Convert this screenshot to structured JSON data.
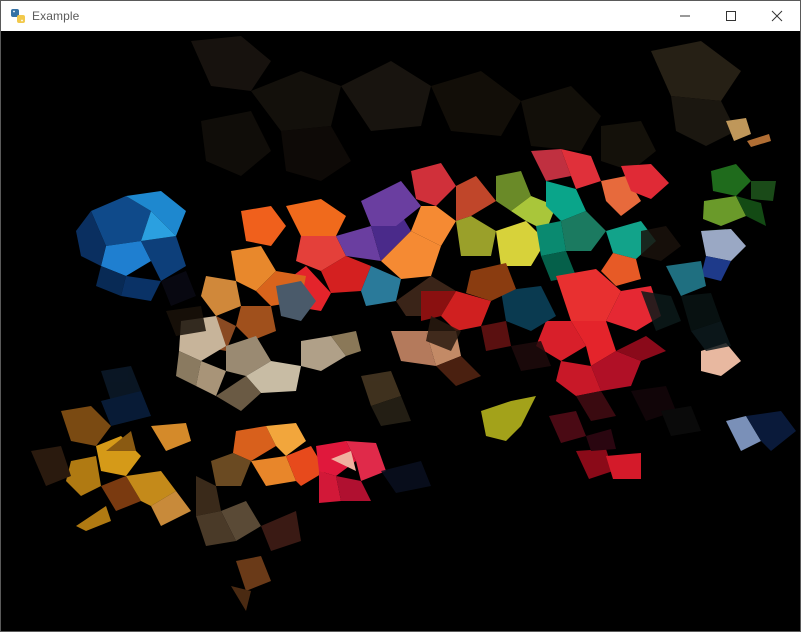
{
  "window": {
    "title": "Example",
    "controls": {
      "minimize_icon": "minimize-icon",
      "maximize_icon": "maximize-icon",
      "close_icon": "close-icon"
    },
    "titlebar_color": "#ffffff",
    "canvas_background": "#000000"
  },
  "app_icon": "python-icon",
  "palette": {
    "blue": "#1f7fd0",
    "orange": "#f06a1c",
    "red": "#e4242b",
    "lime": "#a9c63a",
    "teal": "#0aa58a",
    "purple": "#6a3ea0",
    "beige": "#c7b49a",
    "gold": "#d59a18",
    "pink_red": "#e0183c",
    "dark_green": "#1f6b1c",
    "olive_yellow": "#a3a21a"
  }
}
